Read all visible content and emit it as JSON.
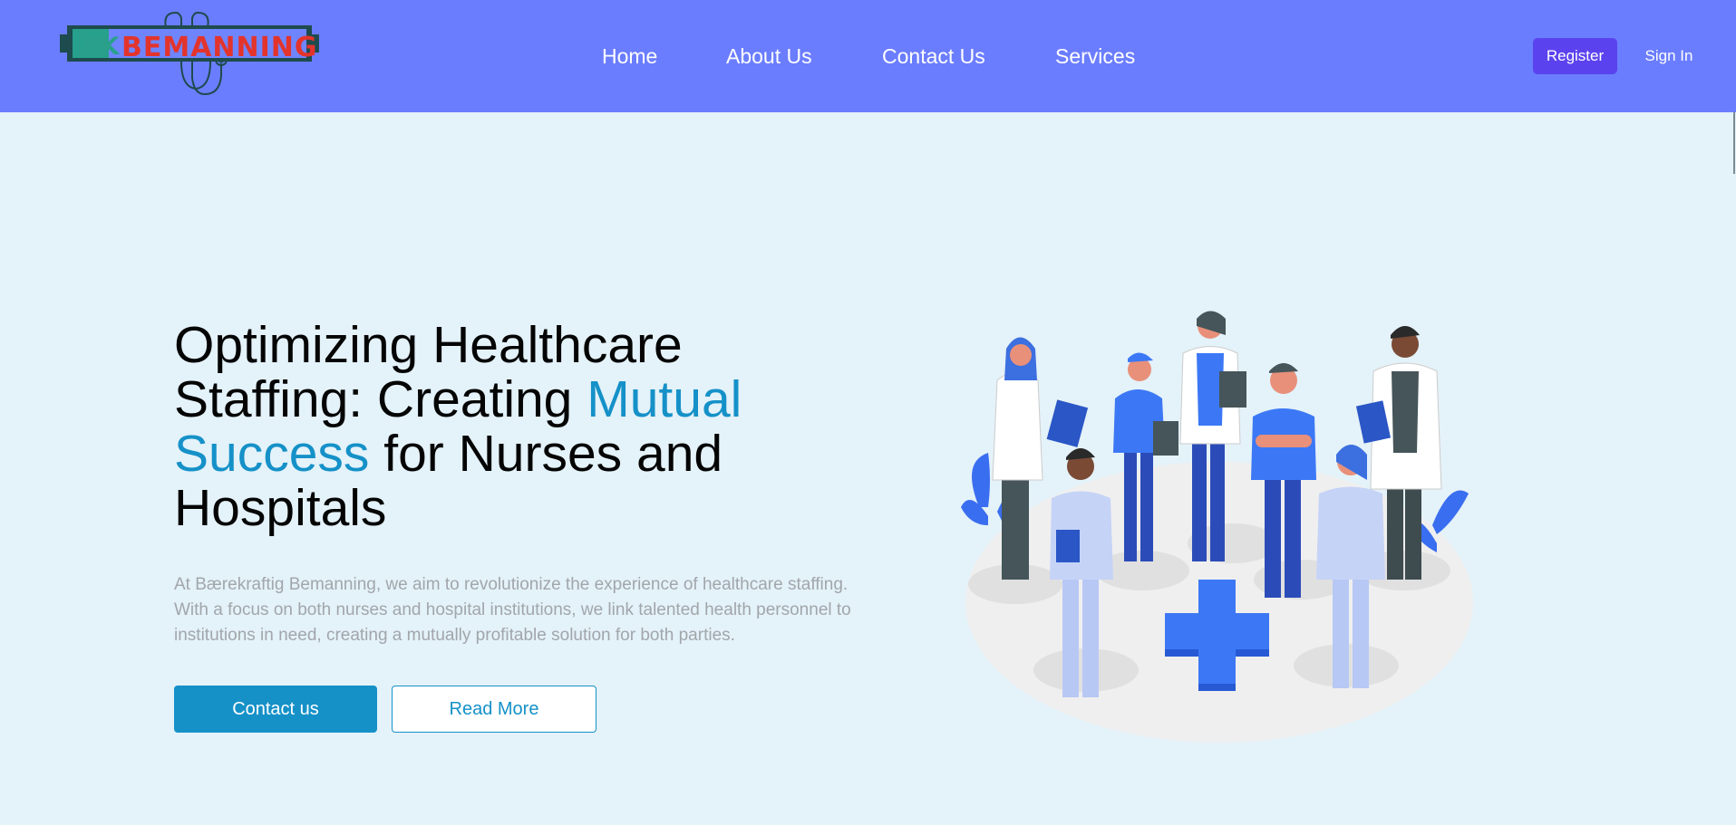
{
  "header": {
    "logo": {
      "mark": "BK",
      "text": "BEMANNING",
      "icon": "stethoscope-icon"
    },
    "nav": [
      {
        "label": "Home"
      },
      {
        "label": "About Us"
      },
      {
        "label": "Contact Us"
      },
      {
        "label": "Services"
      }
    ],
    "register_label": "Register",
    "signin_label": "Sign In"
  },
  "hero": {
    "title_part1": "Optimizing Healthcare Staffing: Creating ",
    "title_accent": "Mutual Success",
    "title_part2": " for Nurses and Hospitals",
    "description": "At Bærekraftig Bemanning, we aim to revolutionize the experience of healthcare staffing. With a focus on both nurses and hospital institutions, we link talented health personnel to institutions in need, creating a mutually profitable solution for both parties.",
    "primary_button": "Contact us",
    "secondary_button": "Read More",
    "illustration": "healthcare-team-illustration"
  },
  "colors": {
    "header_bg": "#6b7dff",
    "page_bg": "#e4f2f9",
    "accent": "#1591c8",
    "register_bg": "#5a43ee",
    "logo_red": "#e3342c",
    "logo_teal": "#2aa08a"
  }
}
